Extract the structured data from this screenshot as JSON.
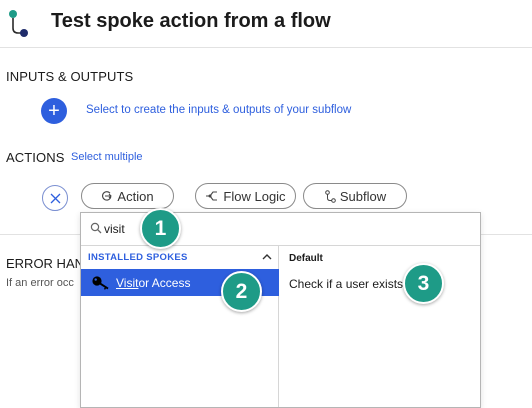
{
  "header": {
    "title": "Test spoke action from a flow"
  },
  "inputs_outputs": {
    "label": "INPUTS & OUTPUTS",
    "add_symbol": "+",
    "hint": "Select to create the inputs & outputs of your subflow"
  },
  "actions": {
    "label": "ACTIONS",
    "select_multiple": "Select multiple",
    "buttons": [
      {
        "label": "Action",
        "icon": "action-arrow-icon"
      },
      {
        "label": "Flow Logic",
        "icon": "flow-logic-icon"
      },
      {
        "label": "Subflow",
        "icon": "subflow-icon"
      }
    ]
  },
  "error_handler": {
    "label": "ERROR HAND",
    "description": "If an error occ"
  },
  "picker": {
    "search_value": "visit",
    "installed_spokes_title": "INSTALLED SPOKES",
    "spoke_match": "Visit",
    "spoke_rest": "or Access",
    "right_header": "Default",
    "action_item": "Check if a user exists"
  },
  "step_badges": [
    "1",
    "2",
    "3"
  ],
  "colors": {
    "accent": "#2e5fde",
    "badge": "#1e9b87",
    "flow_icon_green": "#1e9b87",
    "flow_icon_blue": "#1f2c6b"
  }
}
